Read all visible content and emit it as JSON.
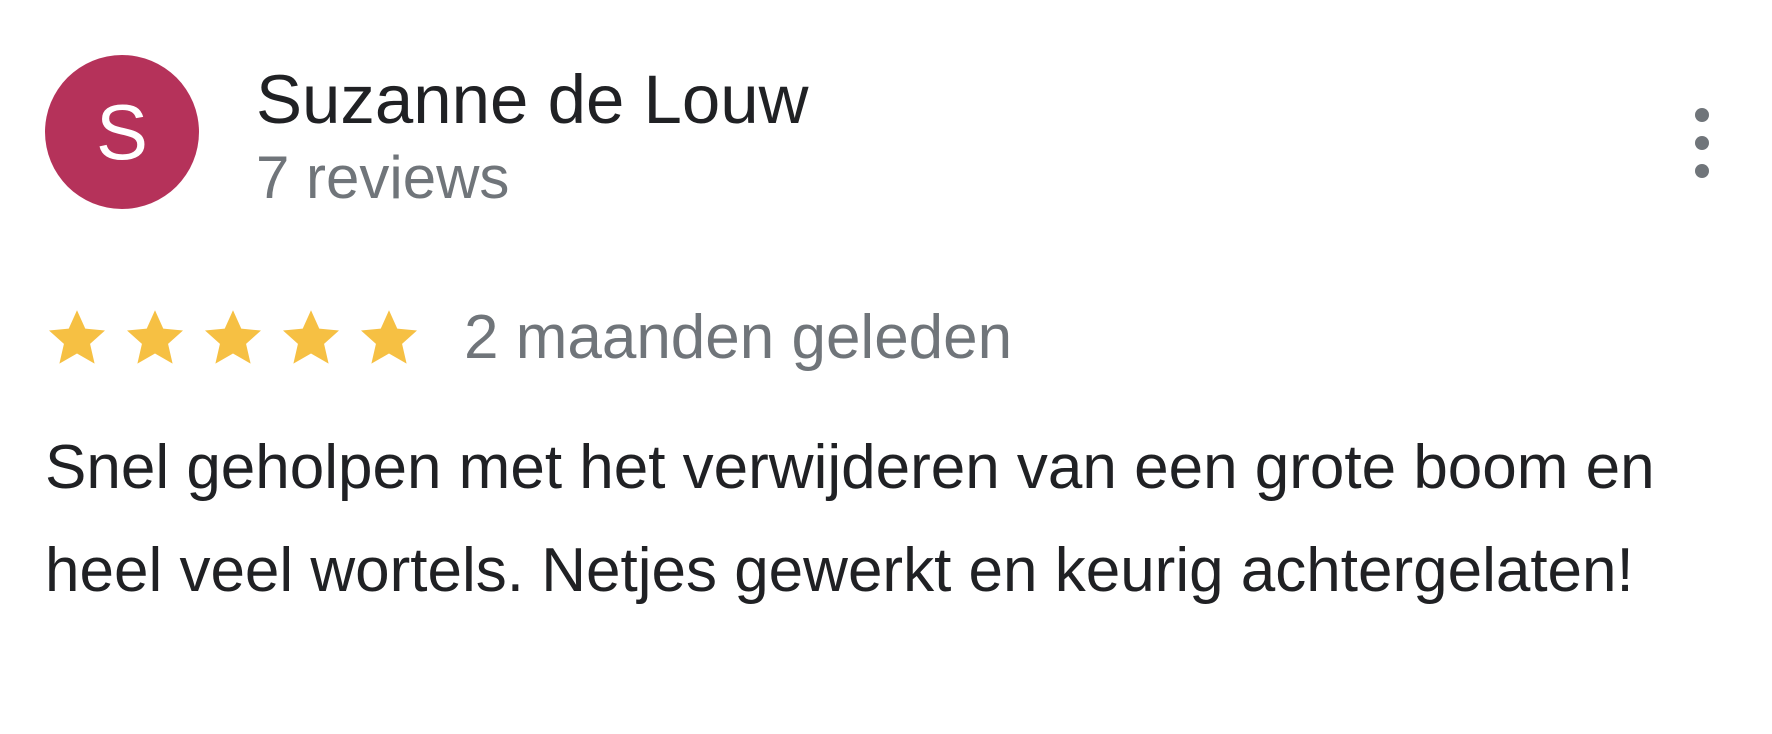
{
  "review": {
    "author": {
      "name": "Suzanne de Louw",
      "initial": "S",
      "avatar_color": "#b5325a",
      "review_count_label": "7 reviews"
    },
    "menu_icon": "more-vert-icon",
    "rating": {
      "stars": 5,
      "max_stars": 5,
      "star_icon": "star-icon",
      "star_color": "#f6c043"
    },
    "date_label": "2 maanden geleden",
    "text": "Snel geholpen met het verwijderen van een grote boom en heel veel wortels. Netjes gewerkt en keurig achtergelaten!"
  },
  "colors": {
    "primary_text": "#202124",
    "secondary_text": "#70757a",
    "menu_icon": "#70757a"
  }
}
